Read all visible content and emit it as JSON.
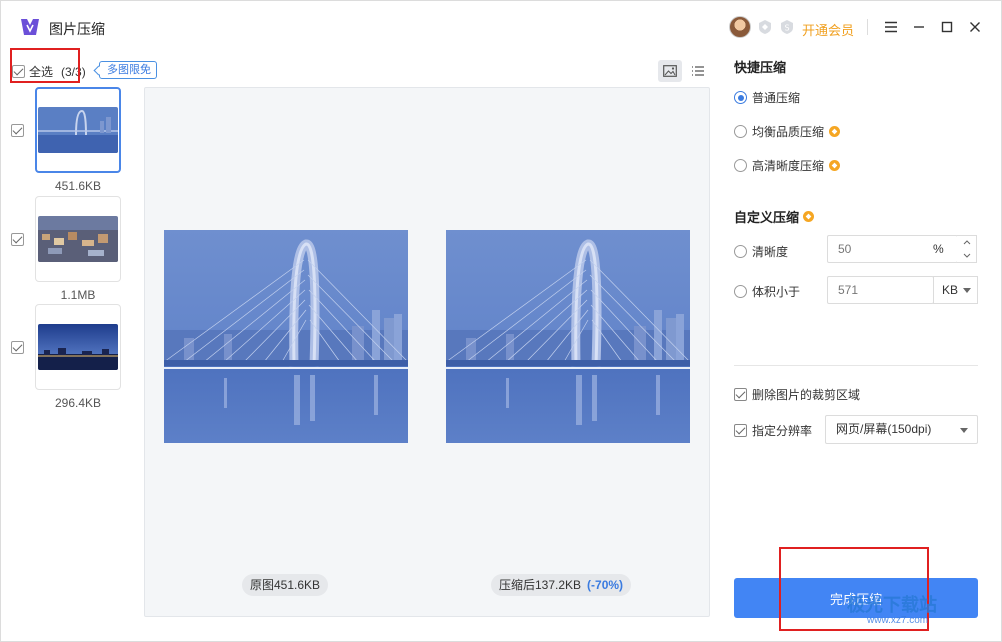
{
  "app": {
    "title": "图片压缩"
  },
  "header": {
    "vip_link": "开通会员"
  },
  "left": {
    "select_all_label": "全选",
    "select_all_count": "(3/3)",
    "multi_tag": "多图限免",
    "thumbnails": [
      {
        "size": "451.6KB",
        "checked": true,
        "active": true
      },
      {
        "size": "1.1MB",
        "checked": true,
        "active": false
      },
      {
        "size": "296.4KB",
        "checked": true,
        "active": false
      }
    ]
  },
  "preview": {
    "original_caption": "原图451.6KB",
    "compressed_caption": "压缩后137.2KB",
    "reduction": "(-70%)"
  },
  "quick": {
    "title": "快捷压缩",
    "options": [
      {
        "label": "普通压缩",
        "selected": true,
        "vip": false
      },
      {
        "label": "均衡品质压缩",
        "selected": false,
        "vip": true
      },
      {
        "label": "高清晰度压缩",
        "selected": false,
        "vip": true
      }
    ]
  },
  "custom": {
    "title": "自定义压缩",
    "clarity_label": "清晰度",
    "clarity_value": "50",
    "clarity_unit": "%",
    "size_label": "体积小于",
    "size_value": "571",
    "size_unit": "KB"
  },
  "options": {
    "remove_crop_label": "删除图片的裁剪区域",
    "resolution_label": "指定分辨率",
    "resolution_value": "网页/屏幕(150dpi)"
  },
  "actions": {
    "finish_label": "完成压缩"
  },
  "watermark": {
    "brand": "极光下载站",
    "url": "www.xz7.com"
  }
}
